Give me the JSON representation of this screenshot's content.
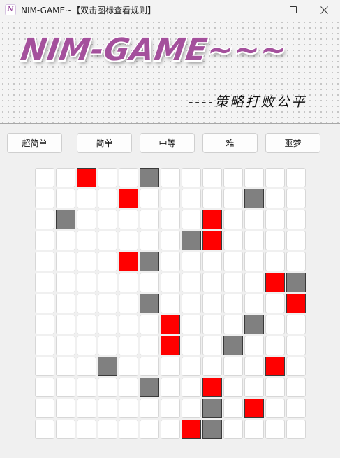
{
  "window": {
    "title": "NIM-GAME~【双击图标查看规则】",
    "icon_text": "N"
  },
  "banner": {
    "title": "NIM-GAME~~~",
    "subtitle": "----策略打败公平"
  },
  "difficulty_buttons": [
    "超简单",
    "简单",
    "中等",
    "难",
    "噩梦"
  ],
  "board": {
    "rows": 13,
    "cols": 13,
    "colors": {
      "empty": "#ffffff",
      "red": "#ff0000",
      "gray": "#808080"
    },
    "red_cells": [
      [
        0,
        2
      ],
      [
        1,
        4
      ],
      [
        2,
        8
      ],
      [
        3,
        8
      ],
      [
        4,
        4
      ],
      [
        5,
        11
      ],
      [
        6,
        12
      ],
      [
        7,
        6
      ],
      [
        8,
        6
      ],
      [
        9,
        11
      ],
      [
        10,
        8
      ],
      [
        11,
        10
      ],
      [
        12,
        7
      ]
    ],
    "gray_cells": [
      [
        0,
        5
      ],
      [
        1,
        10
      ],
      [
        2,
        1
      ],
      [
        3,
        7
      ],
      [
        4,
        5
      ],
      [
        5,
        12
      ],
      [
        6,
        5
      ],
      [
        7,
        10
      ],
      [
        8,
        9
      ],
      [
        9,
        3
      ],
      [
        10,
        5
      ],
      [
        11,
        8
      ],
      [
        12,
        8
      ]
    ]
  }
}
